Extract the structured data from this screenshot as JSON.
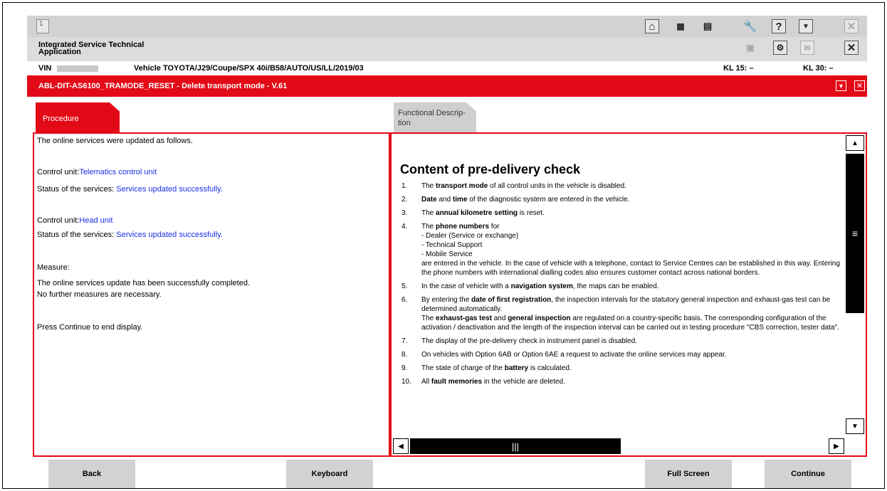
{
  "topbar": {
    "page_number": "1"
  },
  "app": {
    "title_line1": "Integrated Service Technical",
    "title_line2": "Application"
  },
  "vehicle_bar": {
    "vin_label": "VIN",
    "vehicle_label": "Vehicle  TOYOTA/J29/Coupe/SPX 40i/B58/AUTO/US/LL/2019/03",
    "kl15": "KL 15:  –",
    "kl30": "KL 30:  –"
  },
  "title_bar": {
    "title": "ABL-DIT-AS6100_TRAMODE_RESET - Delete transport mode - V.61"
  },
  "tabs": {
    "procedure": "Procedure",
    "functional_1": "Functional Descrip-",
    "functional_2": "tion"
  },
  "procedure": {
    "intro": "The online services were updated as follows.",
    "cu1_label": "Control unit:",
    "cu1_value": "Telematics control unit",
    "status1_label": "Status of the services: ",
    "status1_value": "Services updated successfully.",
    "cu2_label": "Control unit:",
    "cu2_value": "Head unit",
    "status2_label": "Status of the services: ",
    "status2_value": "Services updated successfully.",
    "measure": "Measure:",
    "measure_l1": "The online services update has been successfully completed.",
    "measure_l2": "No further measures are necessary.",
    "press": "Press Continue to end display."
  },
  "doc": {
    "title": "Content of pre-delivery check",
    "items": [
      {
        "n": "1.",
        "parts": [
          [
            "The ",
            0
          ],
          [
            "transport mode",
            1
          ],
          [
            " of all control units in the vehicle is disabled.",
            0
          ]
        ]
      },
      {
        "n": "2.",
        "parts": [
          [
            "Date",
            1
          ],
          [
            " and ",
            0
          ],
          [
            "time",
            1
          ],
          [
            " of the diagnostic system are entered in the vehicle.",
            0
          ]
        ]
      },
      {
        "n": "3.",
        "parts": [
          [
            "The ",
            0
          ],
          [
            "annual kilometre setting",
            1
          ],
          [
            " is reset.",
            0
          ]
        ]
      },
      {
        "n": "4.",
        "parts": [
          [
            "The ",
            0
          ],
          [
            "phone numbers",
            1
          ],
          [
            " for\n- Dealer (Service or exchange)\n- Technical Support\n- Mobile Service\nare entered in the vehicle. In the case of vehicle with a telephone, contact to Service Centres can be established in this way. Entering the phone numbers with international dialling codes also ensures customer contact across national borders.",
            0
          ]
        ]
      },
      {
        "n": "5.",
        "parts": [
          [
            "In the case of vehicle with a ",
            0
          ],
          [
            "navigation system",
            1
          ],
          [
            ", the maps can be enabled.",
            0
          ]
        ]
      },
      {
        "n": "6.",
        "parts": [
          [
            "By entering the ",
            0
          ],
          [
            "date of first registration",
            1
          ],
          [
            ", the inspection intervals for the statutory general inspection and exhaust-gas test can be determined automatically.\nThe ",
            0
          ],
          [
            "exhaust-gas test",
            1
          ],
          [
            " and ",
            0
          ],
          [
            "general inspection",
            1
          ],
          [
            " are regulated on a country-specific basis. The corresponding configuration of the activation / deactivation and the length of the inspection interval can be carried out in testing procedure \"CBS correction, tester data\".",
            0
          ]
        ]
      },
      {
        "n": "7.",
        "parts": [
          [
            "The display of the pre-delivery check in instrument panel is disabled.",
            0
          ]
        ]
      },
      {
        "n": "8.",
        "parts": [
          [
            "On vehicles with Option 6AB or Option 6AE a request to activate the online services may appear.",
            0
          ]
        ]
      },
      {
        "n": "9.",
        "parts": [
          [
            "The state of charge of the ",
            0
          ],
          [
            "battery",
            1
          ],
          [
            " is calculated.",
            0
          ]
        ]
      },
      {
        "n": "10.",
        "parts": [
          [
            "All ",
            0
          ],
          [
            "fault memories",
            1
          ],
          [
            " in the vehicle are deleted.",
            0
          ]
        ]
      }
    ]
  },
  "buttons": {
    "back": "Back",
    "keyboard": "Keyboard",
    "full_screen": "Full Screen",
    "continue": "Continue"
  },
  "colors": {
    "accent_red": "#e30a17",
    "link_blue": "#1a2ee6",
    "bar_gray": "#d2d2d2"
  }
}
